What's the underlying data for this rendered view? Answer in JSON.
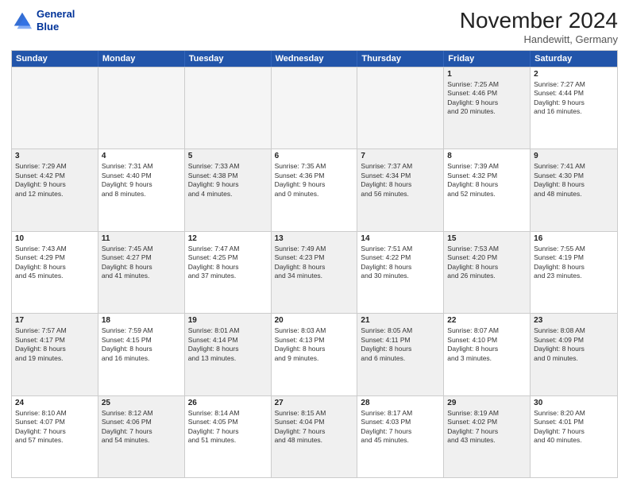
{
  "header": {
    "logo_line1": "General",
    "logo_line2": "Blue",
    "month_title": "November 2024",
    "subtitle": "Handewitt, Germany"
  },
  "days_of_week": [
    "Sunday",
    "Monday",
    "Tuesday",
    "Wednesday",
    "Thursday",
    "Friday",
    "Saturday"
  ],
  "weeks": [
    [
      {
        "day": "",
        "info": "",
        "empty": true
      },
      {
        "day": "",
        "info": "",
        "empty": true
      },
      {
        "day": "",
        "info": "",
        "empty": true
      },
      {
        "day": "",
        "info": "",
        "empty": true
      },
      {
        "day": "",
        "info": "",
        "empty": true
      },
      {
        "day": "1",
        "info": "Sunrise: 7:25 AM\nSunset: 4:46 PM\nDaylight: 9 hours\nand 20 minutes.",
        "shaded": true
      },
      {
        "day": "2",
        "info": "Sunrise: 7:27 AM\nSunset: 4:44 PM\nDaylight: 9 hours\nand 16 minutes.",
        "shaded": false
      }
    ],
    [
      {
        "day": "3",
        "info": "Sunrise: 7:29 AM\nSunset: 4:42 PM\nDaylight: 9 hours\nand 12 minutes.",
        "shaded": true
      },
      {
        "day": "4",
        "info": "Sunrise: 7:31 AM\nSunset: 4:40 PM\nDaylight: 9 hours\nand 8 minutes.",
        "shaded": false
      },
      {
        "day": "5",
        "info": "Sunrise: 7:33 AM\nSunset: 4:38 PM\nDaylight: 9 hours\nand 4 minutes.",
        "shaded": true
      },
      {
        "day": "6",
        "info": "Sunrise: 7:35 AM\nSunset: 4:36 PM\nDaylight: 9 hours\nand 0 minutes.",
        "shaded": false
      },
      {
        "day": "7",
        "info": "Sunrise: 7:37 AM\nSunset: 4:34 PM\nDaylight: 8 hours\nand 56 minutes.",
        "shaded": true
      },
      {
        "day": "8",
        "info": "Sunrise: 7:39 AM\nSunset: 4:32 PM\nDaylight: 8 hours\nand 52 minutes.",
        "shaded": false
      },
      {
        "day": "9",
        "info": "Sunrise: 7:41 AM\nSunset: 4:30 PM\nDaylight: 8 hours\nand 48 minutes.",
        "shaded": true
      }
    ],
    [
      {
        "day": "10",
        "info": "Sunrise: 7:43 AM\nSunset: 4:29 PM\nDaylight: 8 hours\nand 45 minutes.",
        "shaded": false
      },
      {
        "day": "11",
        "info": "Sunrise: 7:45 AM\nSunset: 4:27 PM\nDaylight: 8 hours\nand 41 minutes.",
        "shaded": true
      },
      {
        "day": "12",
        "info": "Sunrise: 7:47 AM\nSunset: 4:25 PM\nDaylight: 8 hours\nand 37 minutes.",
        "shaded": false
      },
      {
        "day": "13",
        "info": "Sunrise: 7:49 AM\nSunset: 4:23 PM\nDaylight: 8 hours\nand 34 minutes.",
        "shaded": true
      },
      {
        "day": "14",
        "info": "Sunrise: 7:51 AM\nSunset: 4:22 PM\nDaylight: 8 hours\nand 30 minutes.",
        "shaded": false
      },
      {
        "day": "15",
        "info": "Sunrise: 7:53 AM\nSunset: 4:20 PM\nDaylight: 8 hours\nand 26 minutes.",
        "shaded": true
      },
      {
        "day": "16",
        "info": "Sunrise: 7:55 AM\nSunset: 4:19 PM\nDaylight: 8 hours\nand 23 minutes.",
        "shaded": false
      }
    ],
    [
      {
        "day": "17",
        "info": "Sunrise: 7:57 AM\nSunset: 4:17 PM\nDaylight: 8 hours\nand 19 minutes.",
        "shaded": true
      },
      {
        "day": "18",
        "info": "Sunrise: 7:59 AM\nSunset: 4:15 PM\nDaylight: 8 hours\nand 16 minutes.",
        "shaded": false
      },
      {
        "day": "19",
        "info": "Sunrise: 8:01 AM\nSunset: 4:14 PM\nDaylight: 8 hours\nand 13 minutes.",
        "shaded": true
      },
      {
        "day": "20",
        "info": "Sunrise: 8:03 AM\nSunset: 4:13 PM\nDaylight: 8 hours\nand 9 minutes.",
        "shaded": false
      },
      {
        "day": "21",
        "info": "Sunrise: 8:05 AM\nSunset: 4:11 PM\nDaylight: 8 hours\nand 6 minutes.",
        "shaded": true
      },
      {
        "day": "22",
        "info": "Sunrise: 8:07 AM\nSunset: 4:10 PM\nDaylight: 8 hours\nand 3 minutes.",
        "shaded": false
      },
      {
        "day": "23",
        "info": "Sunrise: 8:08 AM\nSunset: 4:09 PM\nDaylight: 8 hours\nand 0 minutes.",
        "shaded": true
      }
    ],
    [
      {
        "day": "24",
        "info": "Sunrise: 8:10 AM\nSunset: 4:07 PM\nDaylight: 7 hours\nand 57 minutes.",
        "shaded": false
      },
      {
        "day": "25",
        "info": "Sunrise: 8:12 AM\nSunset: 4:06 PM\nDaylight: 7 hours\nand 54 minutes.",
        "shaded": true
      },
      {
        "day": "26",
        "info": "Sunrise: 8:14 AM\nSunset: 4:05 PM\nDaylight: 7 hours\nand 51 minutes.",
        "shaded": false
      },
      {
        "day": "27",
        "info": "Sunrise: 8:15 AM\nSunset: 4:04 PM\nDaylight: 7 hours\nand 48 minutes.",
        "shaded": true
      },
      {
        "day": "28",
        "info": "Sunrise: 8:17 AM\nSunset: 4:03 PM\nDaylight: 7 hours\nand 45 minutes.",
        "shaded": false
      },
      {
        "day": "29",
        "info": "Sunrise: 8:19 AM\nSunset: 4:02 PM\nDaylight: 7 hours\nand 43 minutes.",
        "shaded": true
      },
      {
        "day": "30",
        "info": "Sunrise: 8:20 AM\nSunset: 4:01 PM\nDaylight: 7 hours\nand 40 minutes.",
        "shaded": false
      }
    ]
  ]
}
